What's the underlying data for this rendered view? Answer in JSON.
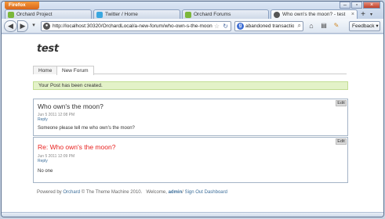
{
  "browser": {
    "menu_button": "Firefox",
    "tabs": [
      {
        "label": "Orchard Project",
        "icon": "orchard-icon",
        "color": "#7bb73b"
      },
      {
        "label": "Twitter / Home",
        "icon": "twitter-icon",
        "color": "#3aa7e0"
      },
      {
        "label": "Orchard Forums",
        "icon": "orchard-icon",
        "color": "#7bb73b"
      },
      {
        "label": "Who own's the moon? - test",
        "icon": "page-icon",
        "color": "#555555"
      }
    ],
    "url": "http://localhost:30320/OrchardLocal/a-new-forum/who-own-s-the-moon",
    "search_text": "abandoned transaction fo",
    "feedback_label": "Feedback"
  },
  "site": {
    "title": "test",
    "menu": [
      "Home",
      "New Forum"
    ],
    "notice": "Your Post has been created."
  },
  "posts": [
    {
      "title": "Who own's the moon?",
      "date": "Jun 5 2011 12:08 PM",
      "reply_label": "Reply",
      "body": "Someone please tell me who own's the moon?",
      "edit_label": "Edit"
    },
    {
      "title": "Re: Who own's the moon?",
      "date": "Jun 5 2011 12:09 PM",
      "reply_label": "Reply",
      "body": "No one",
      "edit_label": "Edit"
    }
  ],
  "footer": {
    "powered_prefix": "Powered by",
    "orchard_link": "Orchard",
    "copyright": "© The Theme Machine 2010.",
    "welcome_prefix": "Welcome,",
    "user_link": "admin",
    "signout_link": "Sign Out",
    "dashboard_link": "Dashboard"
  }
}
